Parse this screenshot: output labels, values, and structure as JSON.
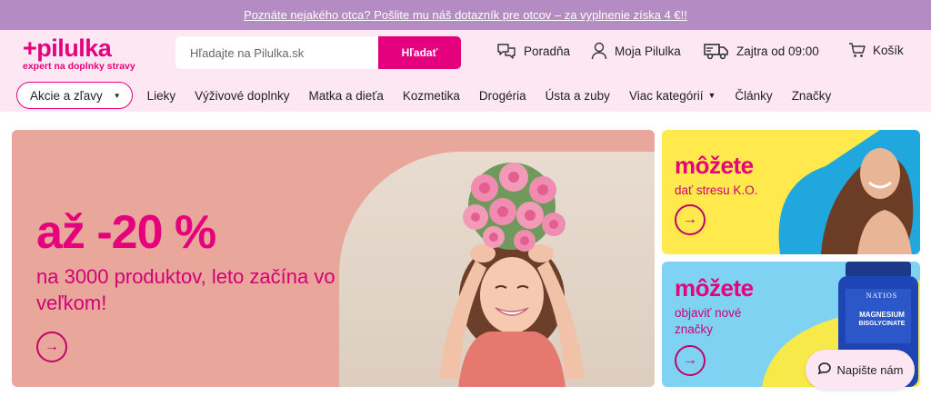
{
  "topbar": {
    "promo_link": "Poznáte nejakého otca? Pošlite mu náš dotazník pre otcov – za vyplnenie získa 4 €!!"
  },
  "logo": {
    "main": "+pilulka",
    "tagline": "expert na doplnky stravy"
  },
  "search": {
    "placeholder": "Hľadajte na Pilulka.sk",
    "button": "Hľadať"
  },
  "header_links": {
    "advice": "Poradňa",
    "account": "Moja Pilulka",
    "delivery": "Zajtra od 09:00",
    "cart": "Košík"
  },
  "nav": {
    "promo": "Akcie a zľavy",
    "items": [
      "Lieky",
      "Výživové doplnky",
      "Matka a dieťa",
      "Kozmetika",
      "Drogéria",
      "Ústa a zuby",
      "Viac kategórií",
      "Články",
      "Značky"
    ]
  },
  "hero": {
    "title": "až -20 %",
    "subtitle": "na 3000 produktov, leto začína vo veľkom!"
  },
  "cards": [
    {
      "title": "môžete",
      "subtitle": "dať stresu K.O."
    },
    {
      "title": "môžete",
      "subtitle": "objaviť nové značky"
    }
  ],
  "product_label": {
    "brand": "NATIOS",
    "line1": "MAGNESIUM",
    "line2": "BISGLYCINATE"
  },
  "chat": {
    "label": "Napište nám"
  },
  "icons": {
    "arrow": "arrow-right-icon",
    "advice": "chat-bubbles-icon",
    "account": "user-icon",
    "delivery": "truck-icon",
    "cart": "cart-icon",
    "chat": "chat-icon"
  },
  "colors": {
    "brand": "#e5007d",
    "header_bg": "#fde7f3",
    "topbar_bg": "#b48bc2",
    "hero_bg": "#e9a79b",
    "card_yellow": "#ffe94c",
    "card_blue": "#7fd2f2"
  }
}
